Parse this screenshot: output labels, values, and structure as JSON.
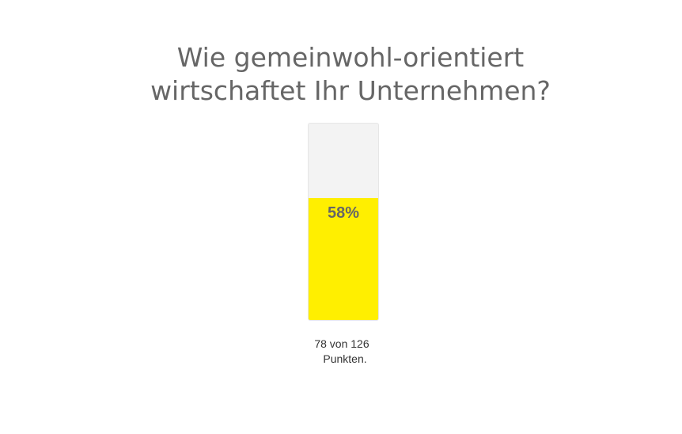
{
  "title": {
    "line1": "Wie gemeinwohl-orientiert",
    "line2": "wirtschaftet Ihr Unternehmen?"
  },
  "progress": {
    "percent_label": "58%",
    "fraction": 0.62,
    "fill_color": "#ffef00",
    "track_color": "#f3f3f3"
  },
  "score": {
    "line1": "78 von 126",
    "line2": "Punkten."
  }
}
